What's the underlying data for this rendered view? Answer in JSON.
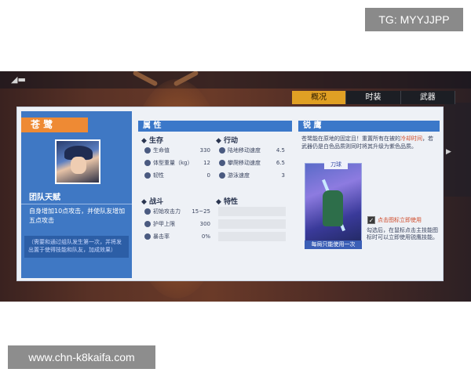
{
  "watermarks": {
    "top": "TG: MYYJJPP",
    "bottom": "www.chn-k8kaifa.com"
  },
  "tabs": [
    "概况",
    "时装",
    "武器"
  ],
  "hero": {
    "name": "苍 鹭",
    "talent_title": "团队天赋",
    "talent_desc": "自身增加10点攻击，并使队友增加五点攻击",
    "talent_note": "（需要和通过组队发生第一次，并将发出置于使得技能和队友，加成效果）"
  },
  "attributes": {
    "header": "属 性",
    "survival": {
      "title": "◆ 生存",
      "rows": [
        {
          "icon": "heart-icon",
          "label": "生命值",
          "value": "330"
        },
        {
          "icon": "weight-icon",
          "label": "体型重量（kg）",
          "value": "12"
        },
        {
          "icon": "shield-icon",
          "label": "韧性",
          "value": "0"
        }
      ]
    },
    "action": {
      "title": "◆ 行动",
      "rows": [
        {
          "icon": "run-icon",
          "label": "陆地移动速度",
          "value": "4.5"
        },
        {
          "icon": "climb-icon",
          "label": "攀爬移动速度",
          "value": "6.5"
        },
        {
          "icon": "swim-icon",
          "label": "游泳速度",
          "value": "3"
        }
      ]
    },
    "combat": {
      "title": "◆ 战斗",
      "rows": [
        {
          "icon": "sword-icon",
          "label": "初始攻击力",
          "value": "15~25"
        },
        {
          "icon": "armor-icon",
          "label": "护甲上限",
          "value": "300"
        },
        {
          "icon": "crit-icon",
          "label": "暴击率",
          "value": "0%"
        }
      ]
    },
    "traits": {
      "title": "◆ 特性"
    }
  },
  "skill": {
    "header": "锐 鹰",
    "desc_before": "苍鹭能在原地的固定且！重置所有在被的",
    "desc_highlight": "冷却时间",
    "desc_after": "，若武器仍是白色品质则同时将其升级为紫色品质。",
    "tag": "刀球",
    "usage": "每局只能使用一次",
    "checkbox_label": "点击图标立即使用",
    "checkbox_desc": "勾选后，在鼠标点击主技能图标时可以立即使用锐鹰技能。"
  }
}
